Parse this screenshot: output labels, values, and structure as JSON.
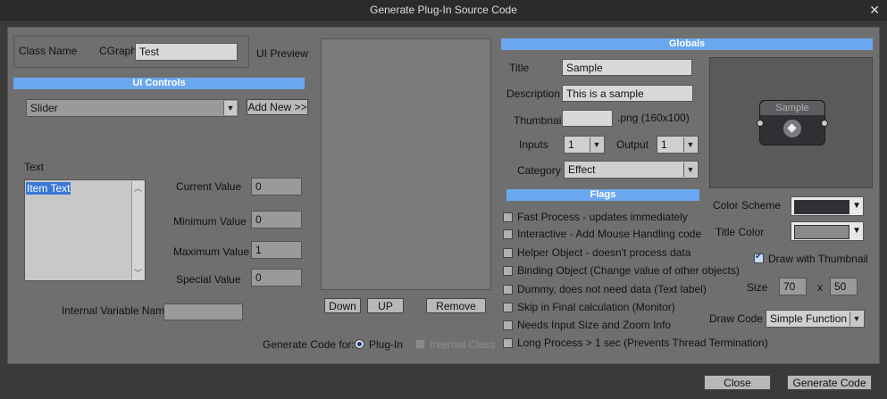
{
  "window": {
    "title": "Generate Plug-In Source Code"
  },
  "class_section": {
    "label": "Class Name",
    "prefix": "CGraph",
    "value": "Test",
    "preview_label": "UI Preview"
  },
  "ui_controls": {
    "header": "UI Controls",
    "selected": "Slider",
    "add_new": "Add New >>",
    "text_label": "Text",
    "list_items": [
      "Item Text"
    ],
    "current_value_label": "Current Value",
    "current_value": "0",
    "minimum_value_label": "Minimum Value",
    "minimum_value": "0",
    "maximum_value_label": "Maximum Value",
    "maximum_value": "1",
    "special_value_label": "Special Value",
    "special_value": "0",
    "internal_var_label": "Internal Variable Name",
    "internal_var_value": ""
  },
  "preview_buttons": {
    "down": "Down",
    "up": "UP",
    "remove": "Remove"
  },
  "generate_for": {
    "label": "Generate Code for:",
    "plugin": "Plug-In",
    "internal": "Internal Class"
  },
  "globals": {
    "header": "Globals",
    "title_label": "Title",
    "title_value": "Sample",
    "description_label": "Description",
    "description_value": "This is a sample",
    "thumbnail_label": "Thumbnail",
    "thumbnail_value": "",
    "thumbnail_suffix": ".png  (160x100)",
    "inputs_label": "Inputs",
    "inputs_value": "1",
    "output_label": "Output",
    "output_value": "1",
    "category_label": "Category",
    "category_value": "Effect"
  },
  "thumbnail_preview": {
    "node_title": "Sample"
  },
  "flags": {
    "header": "Flags",
    "items": [
      {
        "label": "Fast Process - updates immediately",
        "checked": false
      },
      {
        "label": "Interactive - Add Mouse Handling code",
        "checked": false
      },
      {
        "label": "Helper Object - doesn't process data",
        "checked": false
      },
      {
        "label": "Binding Object (Change value of other objects)",
        "checked": false
      },
      {
        "label": "Dummy, does not need data (Text label)",
        "checked": false
      },
      {
        "label": "Skip in Final calculation (Monitor)",
        "checked": false
      },
      {
        "label": "Needs Input Size and Zoom Info",
        "checked": false
      },
      {
        "label": "Long Process > 1 sec (Prevents Thread Termination)",
        "checked": false
      }
    ]
  },
  "appearance": {
    "color_scheme_label": "Color Scheme",
    "color_scheme_color": "#2e3033",
    "title_color_label": "Title Color",
    "title_color_color": "#8a8a8a",
    "draw_thumbnail_label": "Draw with Thumbnail",
    "size_label": "Size",
    "size_w": "70",
    "size_x": "x",
    "size_h": "50",
    "draw_code_label": "Draw Code",
    "draw_code_value": "Simple Function"
  },
  "footer": {
    "close": "Close",
    "generate": "Generate Code"
  },
  "colors": {
    "accent": "#6aa7ee",
    "panel": "#6f6f6f"
  }
}
